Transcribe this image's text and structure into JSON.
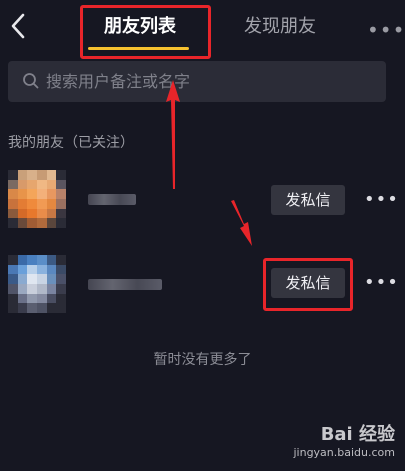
{
  "header": {
    "tabs": [
      {
        "label": "朋友列表",
        "active": true
      },
      {
        "label": "发现朋友",
        "active": false
      }
    ],
    "more_icon": "more-horizontal-icon",
    "back_icon": "chevron-left-icon"
  },
  "search": {
    "placeholder": "搜索用户备注或名字",
    "icon": "search-icon"
  },
  "section": {
    "title": "我的朋友（已关注）"
  },
  "friends": [
    {
      "message_button": "发私信"
    },
    {
      "message_button": "发私信"
    }
  ],
  "empty_text": "暂时没有更多了",
  "watermark": {
    "logo": "Bai 经验",
    "url": "jingyan.baidu.com"
  },
  "colors": {
    "background": "#161722",
    "tab_underline": "#f6c12f",
    "annotation_red": "#e8252a"
  }
}
